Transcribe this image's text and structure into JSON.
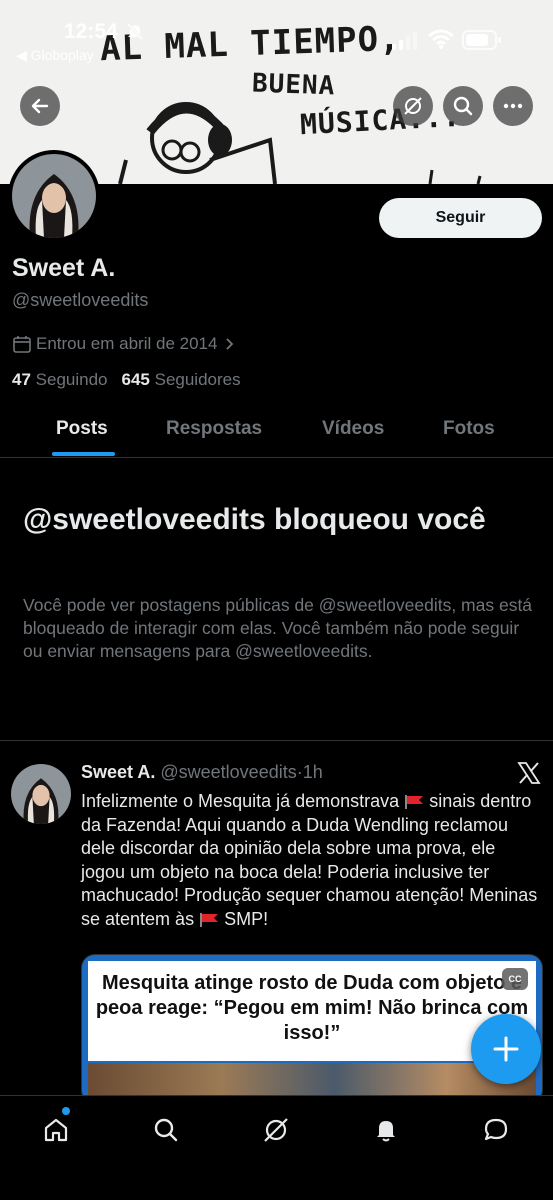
{
  "status_bar": {
    "time": "12:54",
    "back_app": "◀ Globoplay"
  },
  "banner": {
    "line1": "AL MAL TIEMPO,",
    "line2": "BUENA",
    "line3": "MÚSICA..."
  },
  "header_icons": [
    "back-arrow-icon",
    "grok-icon",
    "search-icon",
    "more-icon"
  ],
  "profile": {
    "follow_label": "Seguir",
    "display_name": "Sweet A.",
    "handle": "@sweetloveedits",
    "joined": "Entrou em abril de 2014",
    "following_count": "47",
    "following_label": "Seguindo",
    "followers_count": "645",
    "followers_label": "Seguidores"
  },
  "tabs": [
    {
      "label": "Posts",
      "active": true
    },
    {
      "label": "Respostas",
      "active": false
    },
    {
      "label": "Vídeos",
      "active": false
    },
    {
      "label": "Fotos",
      "active": false
    }
  ],
  "blocked": {
    "title": "@sweetloveedits bloqueou você",
    "description": "Você pode ver postagens públicas de @sweetloveedits, mas está bloqueado de interagir com elas. Você também não pode seguir ou enviar mensagens para @sweetloveedits."
  },
  "tweet": {
    "name": "Sweet A.",
    "handle": "@sweetloveedits",
    "separator": "·",
    "time": "1h",
    "text_part1": "Infelizmente o Mesquita já demonstrava",
    "text_part2": "sinais dentro da Fazenda! Aqui quando a Duda Wendling reclamou dele discordar da opinião dela sobre uma prova, ele jogou um objeto na boca dela! Poderia inclusive ter machucado! Produção sequer chamou atenção! Meninas se atentem às",
    "text_part3": "SMP!",
    "media_title": "Mesquita atinge rosto de Duda com objeto e peoa reage: “Pegou em mim! Não brinca com isso!”",
    "cc_badge": "CC"
  },
  "colors": {
    "accent": "#1d9bf0",
    "background": "#000000",
    "secondary_text": "#71767b",
    "primary_text": "#e7e9ea"
  },
  "bottom_nav": [
    "home-icon",
    "search-icon",
    "grok-icon",
    "notifications-icon",
    "messages-icon"
  ]
}
